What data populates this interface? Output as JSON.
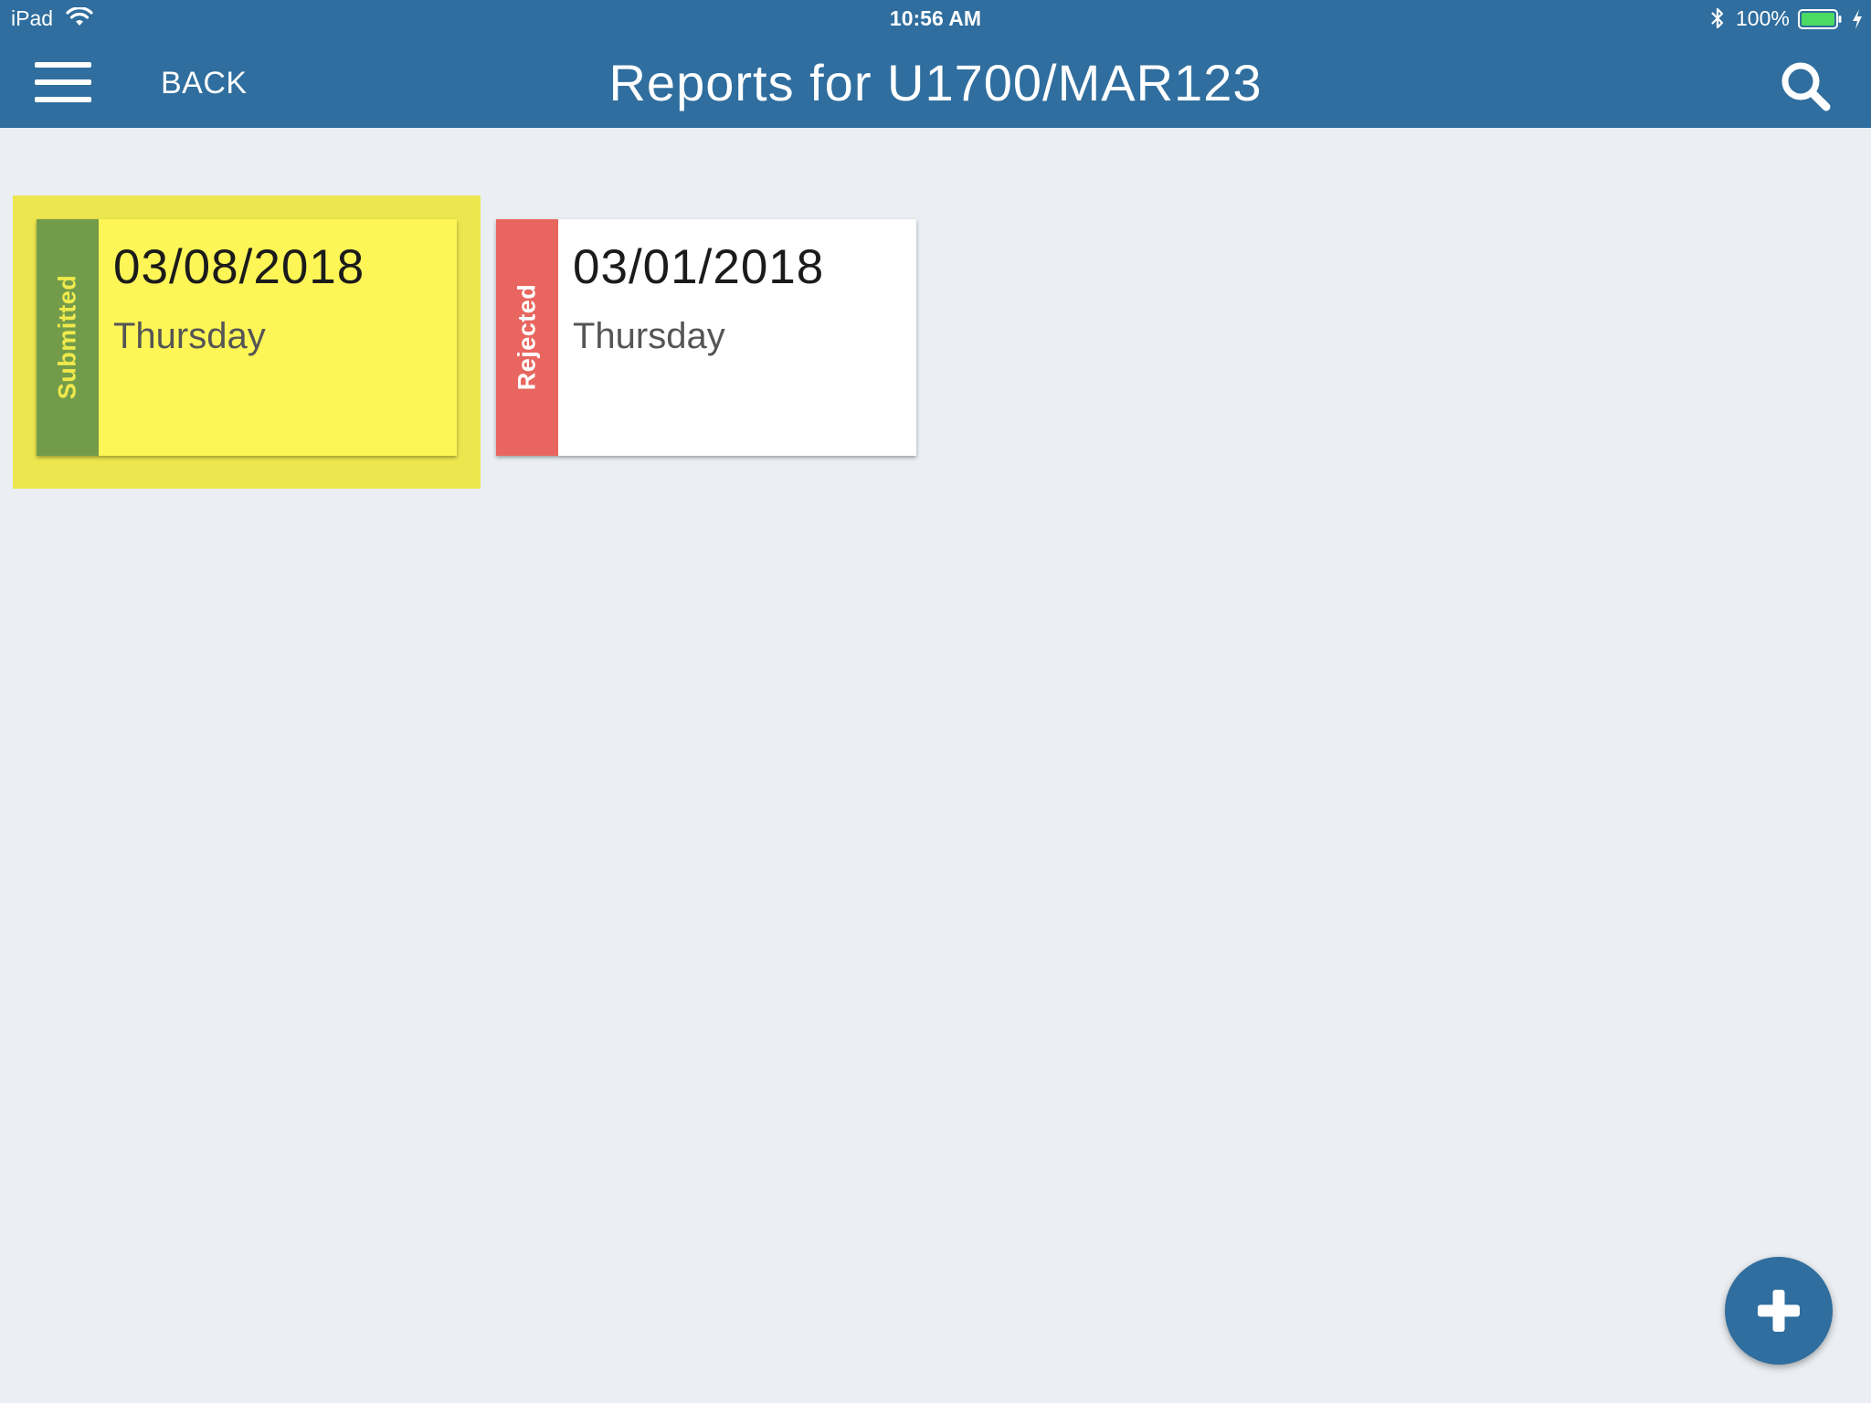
{
  "status_bar": {
    "device": "iPad",
    "time": "10:56 AM",
    "battery": "100%",
    "icons": [
      "wifi-icon",
      "bluetooth-icon",
      "battery-icon",
      "charging-icon"
    ]
  },
  "header": {
    "menu_icon": "hamburger-menu-icon",
    "back_label": "BACK",
    "title": "Reports for U1700/MAR123",
    "search_icon": "search-icon",
    "background_color": "#2f6e9e"
  },
  "reports": [
    {
      "status": "Submitted",
      "date": "03/08/2018",
      "day": "Thursday",
      "selected": true,
      "status_color": "#739c4a",
      "status_text_color": "#f0ea4c",
      "card_color": "#fef656"
    },
    {
      "status": "Rejected",
      "date": "03/01/2018",
      "day": "Thursday",
      "selected": false,
      "status_color": "#e8665f",
      "status_text_color": "#ffffff",
      "card_color": "#ffffff"
    }
  ],
  "fab": {
    "icon": "plus-icon",
    "color": "#2f6e9e"
  },
  "colors": {
    "page_background": "#ebeff3",
    "selection_highlight": "#ede74f"
  }
}
